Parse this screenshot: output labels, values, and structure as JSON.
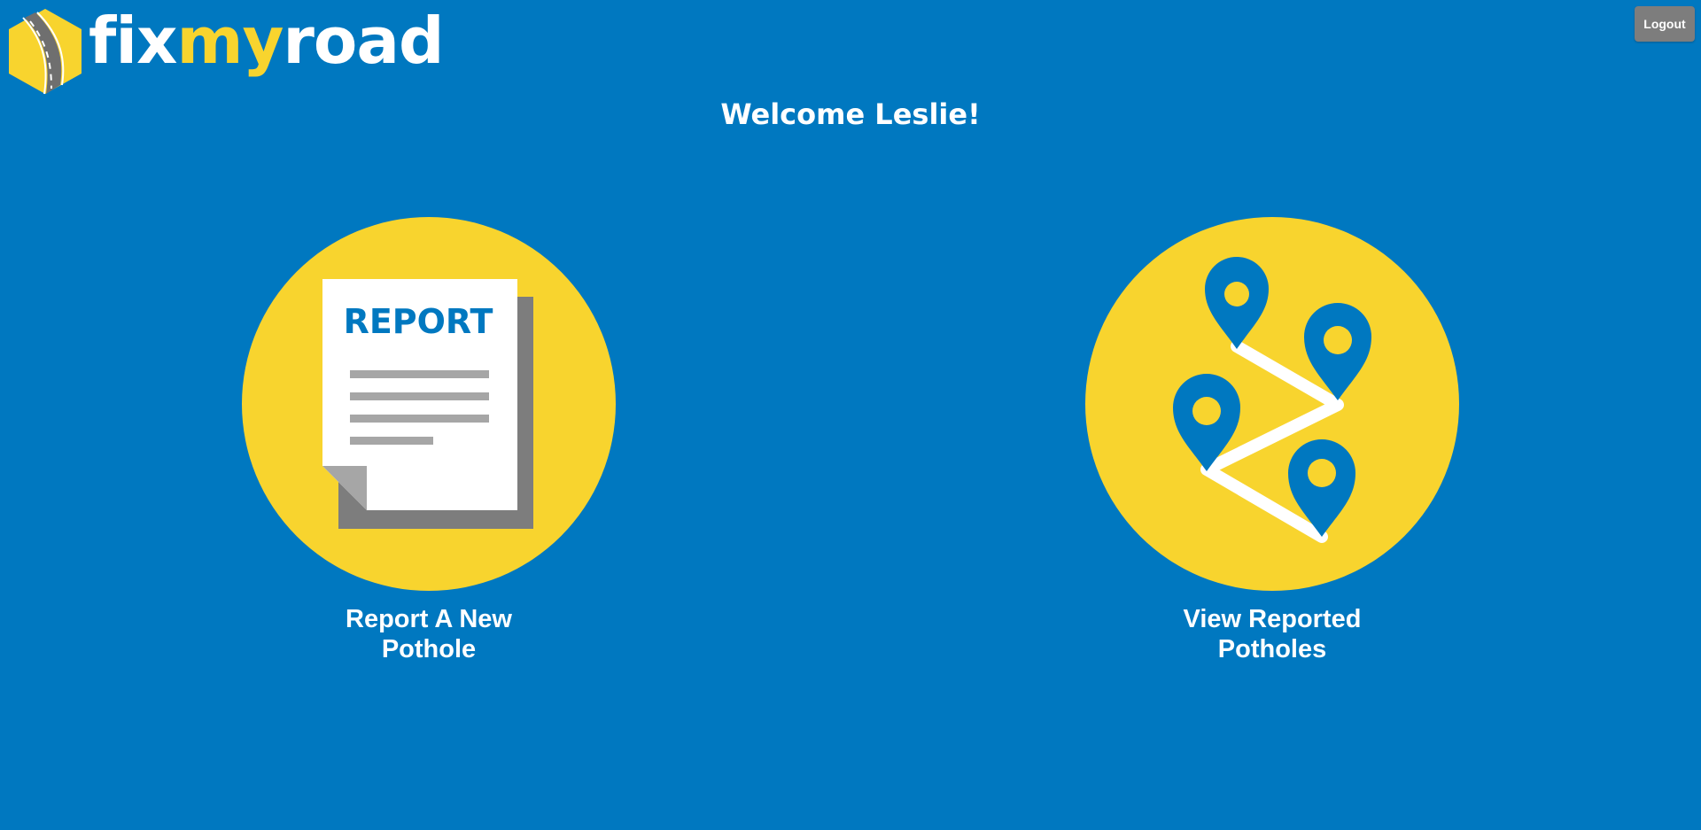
{
  "app": {
    "logo": {
      "wordmark_parts": [
        "fix",
        "my",
        "road"
      ],
      "icon": "road-hexagon-icon"
    },
    "logout_label": "Logout",
    "welcome_text": "Welcome Leslie!"
  },
  "actions": [
    {
      "label": "Report A New Pothole",
      "icon": "report-document-icon",
      "icon_text": "REPORT"
    },
    {
      "label": "View Reported Potholes",
      "icon": "map-pins-route-icon"
    }
  ],
  "colors": {
    "background": "#0078c0",
    "accent_yellow": "#f8d42e",
    "white": "#ffffff",
    "gray": "#7d7d7d"
  }
}
